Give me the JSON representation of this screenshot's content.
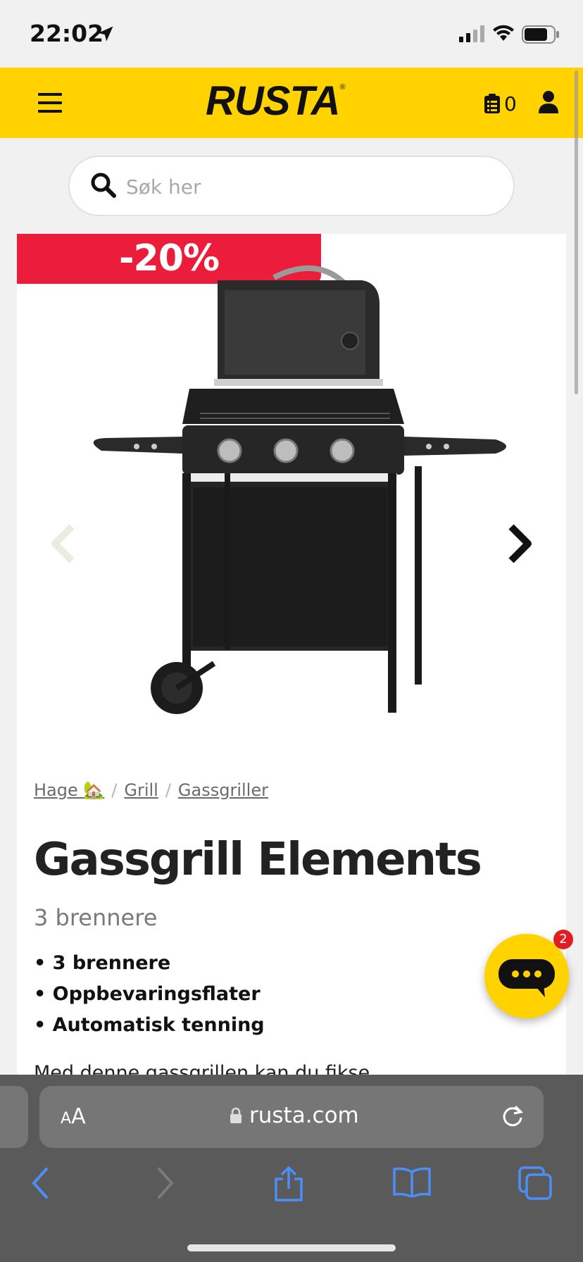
{
  "status_bar": {
    "time": "22:02"
  },
  "header": {
    "logo": "RUSTA",
    "logo_mark": "®",
    "cart_count": "0"
  },
  "search": {
    "placeholder": "Søk her"
  },
  "product": {
    "discount_badge": "-20%",
    "breadcrumbs": [
      {
        "label": "Hage 🏡"
      },
      {
        "label": "Grill"
      },
      {
        "label": "Gassgriller"
      }
    ],
    "breadcrumb_separator": "/",
    "title": "Gassgrill Elements",
    "subtitle": "3 brennere",
    "features": [
      "• 3 brennere",
      "• Oppbevaringsflater",
      "• Automatisk tenning"
    ],
    "description": "Med denne gassgrillen kan du fikse"
  },
  "chat": {
    "unread_count": "2"
  },
  "browser": {
    "text_size_small": "A",
    "text_size_large": "A",
    "url": "rusta.com"
  },
  "colors": {
    "brand_yellow": "#ffd200",
    "badge_red": "#ec1c3b",
    "safari_blue": "#4c8ef7"
  },
  "icons": [
    "location-arrow-icon",
    "cellular-signal-icon",
    "wifi-icon",
    "battery-icon",
    "hamburger-menu-icon",
    "shopping-list-icon",
    "user-icon",
    "search-icon",
    "chevron-left-icon",
    "chevron-right-icon",
    "chat-bubble-icon",
    "lock-icon",
    "reload-icon",
    "back-icon",
    "forward-icon",
    "share-icon",
    "bookmarks-icon",
    "tabs-icon"
  ]
}
